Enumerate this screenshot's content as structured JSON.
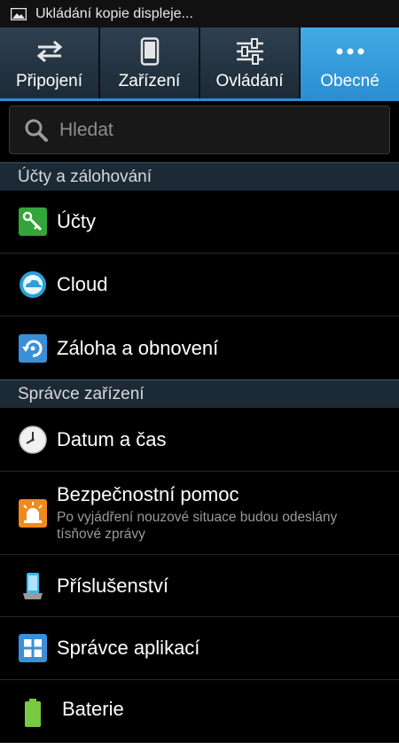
{
  "status_bar": {
    "notification_text": "Ukládání kopie displeje..."
  },
  "tabs": [
    {
      "label": "Připojení",
      "icon": "swap-arrows-icon",
      "active": false
    },
    {
      "label": "Zařízení",
      "icon": "phone-device-icon",
      "active": false
    },
    {
      "label": "Ovládání",
      "icon": "sliders-icon",
      "active": false
    },
    {
      "label": "Obecné",
      "icon": "more-dots-icon",
      "active": true
    }
  ],
  "search": {
    "placeholder": "Hledat",
    "value": ""
  },
  "sections": [
    {
      "title": "Účty a zálohování",
      "items": [
        {
          "title": "Účty",
          "icon": "accounts-key-icon"
        },
        {
          "title": "Cloud",
          "icon": "cloud-icon"
        },
        {
          "title": "Záloha a obnovení",
          "icon": "backup-restore-icon"
        }
      ]
    },
    {
      "title": "Správce zařízení",
      "items": [
        {
          "title": "Datum a čas",
          "icon": "clock-icon"
        },
        {
          "title": "Bezpečnostní pomoc",
          "subtitle": "Po vyjádření nouzové situace budou odeslány tísňové zprávy",
          "icon": "siren-icon"
        },
        {
          "title": "Příslušenství",
          "icon": "accessory-dock-icon"
        },
        {
          "title": "Správce aplikací",
          "icon": "app-grid-icon"
        },
        {
          "title": "Baterie",
          "icon": "battery-icon"
        }
      ]
    }
  ],
  "colors": {
    "accent": "#33a0e0",
    "section_bg": "#1c2a36",
    "tab_bg": "#24323f"
  }
}
